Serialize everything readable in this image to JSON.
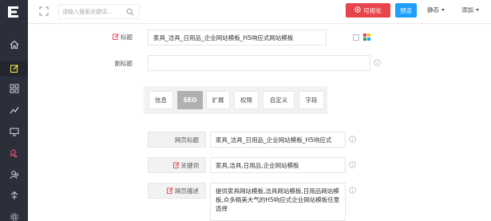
{
  "sidebar": {
    "logo": "E",
    "items": [
      {
        "icon": "home-icon"
      },
      {
        "icon": "edit-icon",
        "active": true
      },
      {
        "icon": "grid-icon"
      },
      {
        "icon": "chart-icon"
      },
      {
        "icon": "monitor-icon"
      },
      {
        "icon": "puzzle-icon"
      },
      {
        "icon": "users-icon"
      },
      {
        "icon": "share-icon"
      },
      {
        "icon": "gear-icon"
      }
    ]
  },
  "topbar": {
    "search_placeholder": "请输入搜索关键词...",
    "visual_button": "可视化",
    "preview_button": "预览",
    "static_menu": "静态",
    "add_menu": "添加"
  },
  "form": {
    "title_label": "标题",
    "title_value": "家具_洁具_日用品_企业网站模板_H5响应式网站模板",
    "subtitle_label": "副标题",
    "subtitle_value": ""
  },
  "tabs": [
    {
      "label": "信息"
    },
    {
      "label": "SEO",
      "active": true
    },
    {
      "label": "扩展"
    },
    {
      "label": "权限"
    },
    {
      "label": "自定义"
    },
    {
      "label": "字段"
    }
  ],
  "seo": {
    "page_title_label": "网页标题",
    "page_title_value": "家具_洁具_日用品_企业网站模板_H5响应式",
    "keywords_label": "关键词",
    "keywords_value": "家具,洁具,日用品,企业网站模板",
    "description_label": "网页描述",
    "description_value": "提供家具网站模板,洁具网站模板,日用品网站模板,众多精美大气的H5响应式企业网站模板任意选择"
  },
  "colors": {
    "sidebar_bg": "#2b2f3a",
    "visual_btn": "#e9444b",
    "preview_btn": "#1e9fff",
    "required_icon": "#e9444b"
  }
}
